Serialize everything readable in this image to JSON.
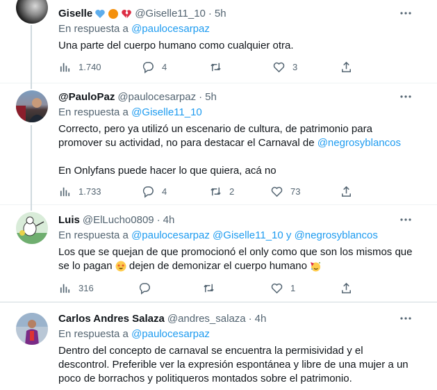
{
  "tweets": [
    {
      "name": "Giselle",
      "handle": "@Giselle11_10",
      "time": "5h",
      "reply_label": "En respuesta a",
      "reply_to": "@paulocesarpaz",
      "reply_and": "",
      "text_lines": [
        "Una parte del cuerpo humano como cualquier otra."
      ],
      "stats": {
        "views": "1.740",
        "replies": "4",
        "retweets": "",
        "likes": "3"
      },
      "name_emojis": [
        "blue-heart",
        "orange-circle",
        "broken-heart"
      ]
    },
    {
      "name": "@PauloPaz",
      "handle": "@paulocesarpaz",
      "time": "5h",
      "reply_label": "En respuesta a",
      "reply_to": "@Giselle11_10",
      "text_a": "Correcto, pero ya utilizó un escenario de cultura, de patrimonio para",
      "text_b_pre": "promover su actividad, no para destacar el Carnaval de ",
      "text_b_mention": "@negrosyblancos",
      "text_c": "En Onlyfans puede hacer lo que quiera, acá no",
      "stats": {
        "views": "1.733",
        "replies": "4",
        "retweets": "2",
        "likes": "73"
      }
    },
    {
      "name": "Luis",
      "handle": "@ElLucho0809",
      "time": "4h",
      "reply_label": "En respuesta a",
      "reply_to_1": "@paulocesarpaz",
      "reply_to_2": "@Giselle11_10",
      "reply_and": "y",
      "reply_to_3": "@negrosyblancos",
      "text_a": "Los que se quejan de que promocionó el only como que son los mismos que",
      "text_b_pre": "se lo pagan ",
      "text_b_post": " dejen de demonizar el cuerpo humano ",
      "stats": {
        "views": "316",
        "replies": "",
        "retweets": "",
        "likes": "1"
      }
    },
    {
      "name": "Carlos Andres Salaza",
      "handle": "@andres_salaza",
      "time": "4h",
      "reply_label": "En respuesta a",
      "reply_to": "@paulocesarpaz",
      "text_lines": [
        "Dentro del concepto de carnaval se encuentra la permisividad y el",
        "descontrol. Preferible ver la expresión espontánea y libre de una mujer  a un",
        "poco de borrachos y politiqueros montados sobre el patrimonio."
      ]
    }
  ],
  "separator": "·",
  "colors": {
    "link": "#1d9bf0",
    "secondary": "#536471",
    "text": "#0f1419",
    "line": "#cfd9de"
  },
  "icons": [
    "views-icon",
    "reply-icon",
    "retweet-icon",
    "like-icon",
    "share-icon",
    "more-icon"
  ]
}
